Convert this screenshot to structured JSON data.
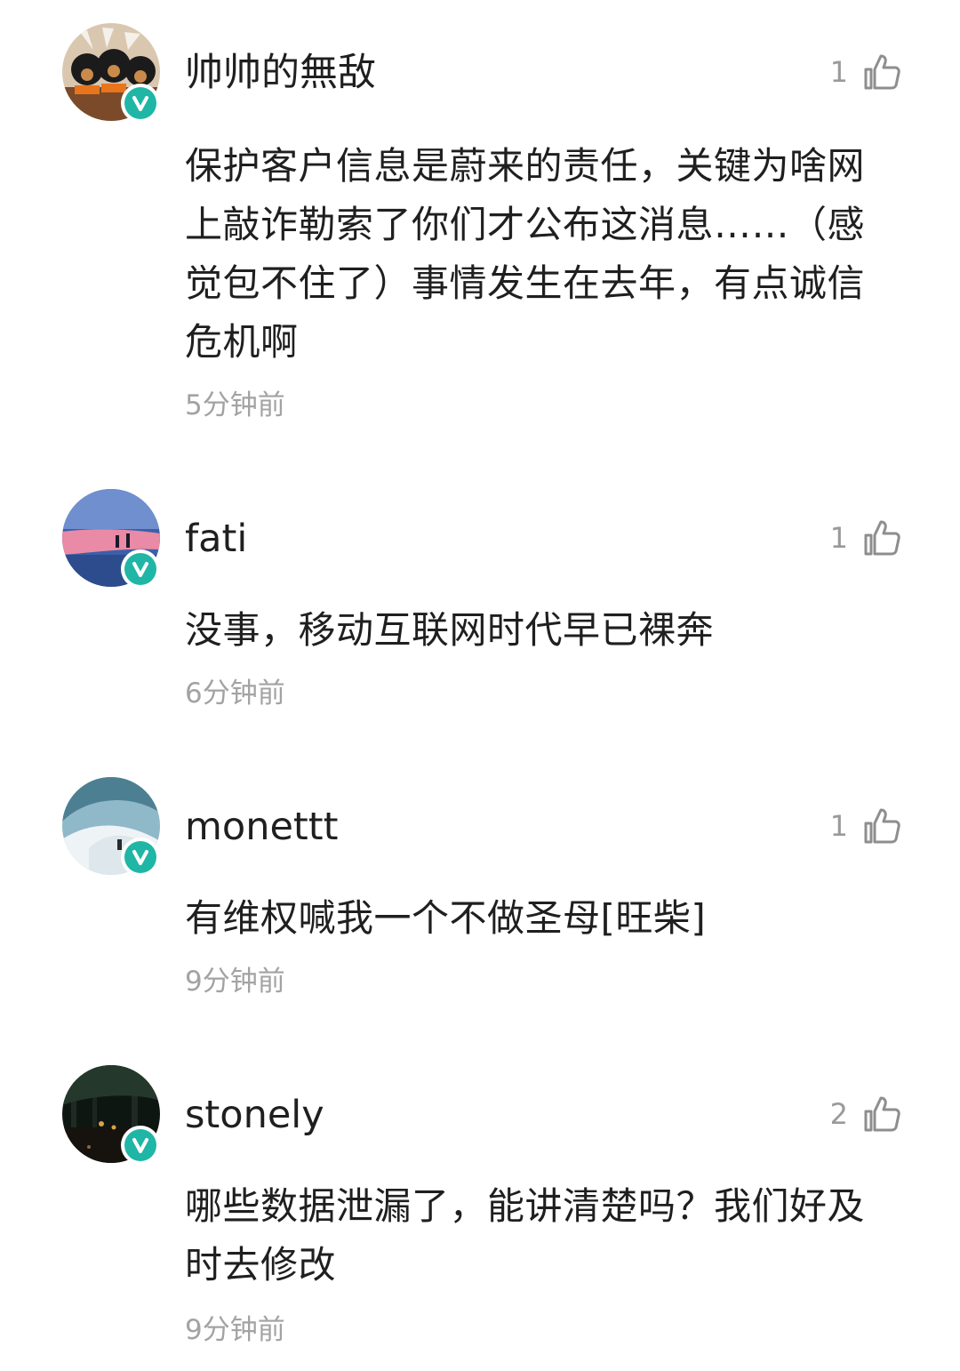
{
  "comments": [
    {
      "username": "帅帅的無敌",
      "likes": "1",
      "text": "保护客户信息是蔚来的责任，关键为啥网上敲诈勒索了你们才公布这消息……（感觉包不住了）事情发生在去年，有点诚信危机啊",
      "time": "5分钟前",
      "avatar_icon": "plush-toys-avatar-icon"
    },
    {
      "username": "fati",
      "likes": "1",
      "text": "没事，移动互联网时代早已裸奔",
      "time": "6分钟前",
      "avatar_icon": "pink-sky-avatar-icon"
    },
    {
      "username": "monettt",
      "likes": "1",
      "text": "有维权喊我一个不做圣母[旺柴]",
      "time": "9分钟前",
      "avatar_icon": "ice-cave-avatar-icon"
    },
    {
      "username": "stonely",
      "likes": "2",
      "text": "哪些数据泄漏了，能讲清楚吗？我们好及时去修改",
      "time": "9分钟前",
      "avatar_icon": "night-forest-avatar-icon"
    }
  ],
  "colors": {
    "verified_badge": "#1fb6a6",
    "meta_text": "#a3a3a3",
    "body_text": "#1f1f1f"
  },
  "icons": {
    "like": "thumbs-up-icon",
    "verified": "verified-v-icon"
  }
}
